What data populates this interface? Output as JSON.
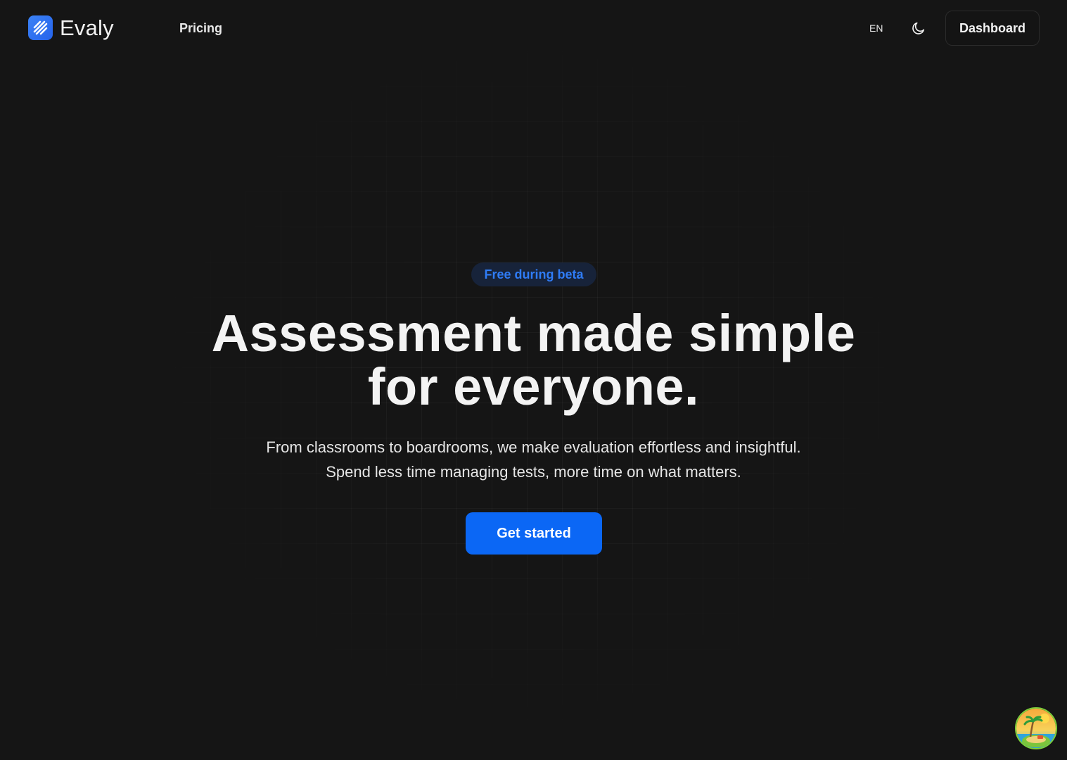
{
  "header": {
    "brand": "Evaly",
    "nav_pricing": "Pricing",
    "language": "EN",
    "dashboard_label": "Dashboard"
  },
  "hero": {
    "badge": "Free during beta",
    "headline_line1": "Assessment made simple",
    "headline_line2": "for everyone.",
    "subtitle_line1": "From classrooms to boardrooms, we make evaluation effortless and insightful.",
    "subtitle_line2": "Spend less time managing tests, more time on what matters.",
    "cta_label": "Get started"
  },
  "icons": {
    "logo": "evaly-logo-icon",
    "theme": "moon-icon",
    "avatar": "beach-avatar-icon"
  },
  "colors": {
    "background": "#151515",
    "accent": "#0b67f5",
    "badge_text": "#2f7cf6",
    "badge_bg": "#17233a"
  }
}
